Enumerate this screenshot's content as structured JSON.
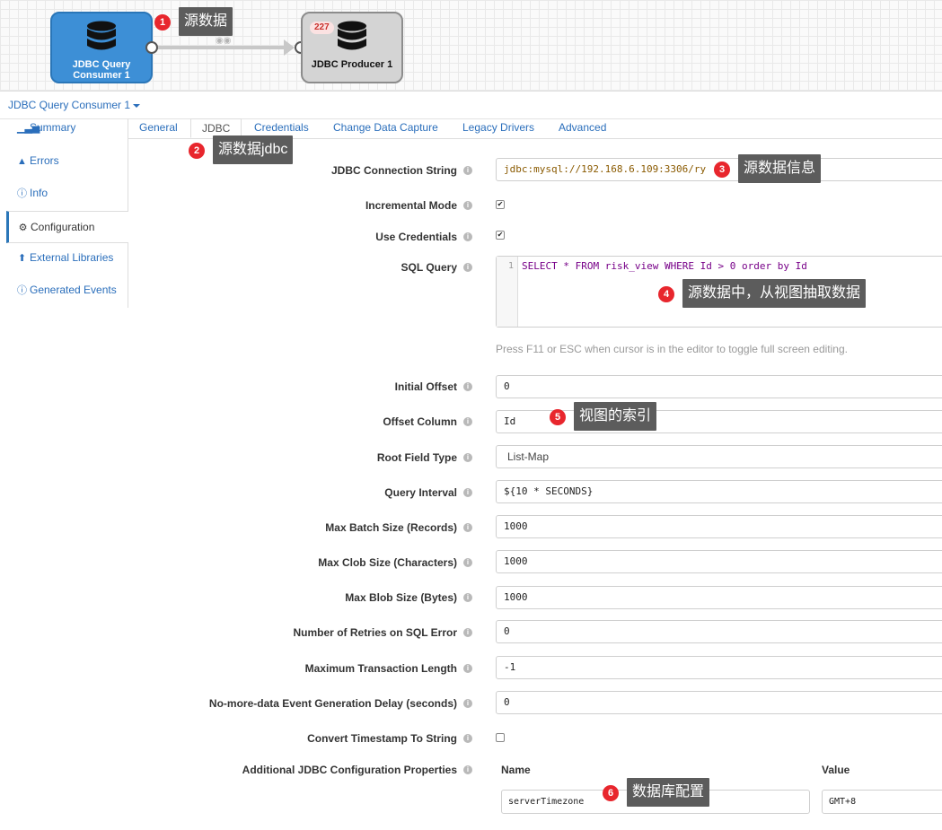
{
  "canvas": {
    "origin_stage": {
      "line1": "JDBC Query",
      "line2": "Consumer 1",
      "icon": "database-icon"
    },
    "dest_stage": {
      "label": "JDBC Producer 1",
      "record_count": "227",
      "icon": "database-icon"
    },
    "link_icon": "glasses-icon"
  },
  "header": {
    "stage_selector": "JDBC Query Consumer 1"
  },
  "side_nav": [
    {
      "label": "Summary",
      "icon": "bar-chart-icon"
    },
    {
      "label": "Errors",
      "icon": "warning-icon"
    },
    {
      "label": "Info",
      "icon": "info-icon"
    },
    {
      "label": "Configuration",
      "icon": "gear-icon",
      "active": true
    },
    {
      "label": "External Libraries",
      "icon": "upload-icon"
    },
    {
      "label": "Generated Events",
      "icon": "info-icon"
    }
  ],
  "tabs": [
    {
      "label": "General"
    },
    {
      "label": "JDBC",
      "active": true
    },
    {
      "label": "Credentials"
    },
    {
      "label": "Change Data Capture"
    },
    {
      "label": "Legacy Drivers"
    },
    {
      "label": "Advanced"
    }
  ],
  "form": {
    "jdbc_connection_string": {
      "label": "JDBC Connection String",
      "value": "jdbc:mysql://192.168.6.109:3306/ry"
    },
    "incremental_mode": {
      "label": "Incremental Mode",
      "checked": true
    },
    "use_credentials": {
      "label": "Use Credentials",
      "checked": true
    },
    "sql_query": {
      "label": "SQL Query",
      "line_number": "1",
      "code": "SELECT * FROM risk_view WHERE Id > 0 order by Id",
      "hint": "Press F11 or ESC when cursor is in the editor to toggle full screen editing."
    },
    "initial_offset": {
      "label": "Initial Offset",
      "value": "0"
    },
    "offset_column": {
      "label": "Offset Column",
      "value": "Id"
    },
    "root_field_type": {
      "label": "Root Field Type",
      "value": "List-Map"
    },
    "query_interval": {
      "label": "Query Interval",
      "value": "${10 * SECONDS}"
    },
    "max_batch_size": {
      "label": "Max Batch Size (Records)",
      "value": "1000"
    },
    "max_clob_size": {
      "label": "Max Clob Size (Characters)",
      "value": "1000"
    },
    "max_blob_size": {
      "label": "Max Blob Size (Bytes)",
      "value": "1000"
    },
    "retries_on_sql_error": {
      "label": "Number of Retries on SQL Error",
      "value": "0"
    },
    "max_transaction_length": {
      "label": "Maximum Transaction Length",
      "value": "-1"
    },
    "no_more_data_delay": {
      "label": "No-more-data Event Generation Delay (seconds)",
      "value": "0"
    },
    "convert_timestamp": {
      "label": "Convert Timestamp To String",
      "checked": false
    },
    "additional_props": {
      "label": "Additional JDBC Configuration Properties",
      "name_header": "Name",
      "value_header": "Value",
      "rows": [
        {
          "name": "serverTimezone",
          "value": "GMT+8"
        }
      ]
    }
  },
  "annotations": [
    {
      "num": "1",
      "text": "源数据"
    },
    {
      "num": "2",
      "text": "源数据jdbc"
    },
    {
      "num": "3",
      "text": "源数据信息"
    },
    {
      "num": "4",
      "text": "源数据中，从视图抽取数据"
    },
    {
      "num": "5",
      "text": "视图的索引"
    },
    {
      "num": "6",
      "text": "数据库配置"
    }
  ],
  "colors": {
    "accent": "#2a6ebb",
    "origin_stage": "#3d8fd6",
    "annotation_badge": "#e8262d",
    "annotation_box": "#5c5c5c"
  }
}
